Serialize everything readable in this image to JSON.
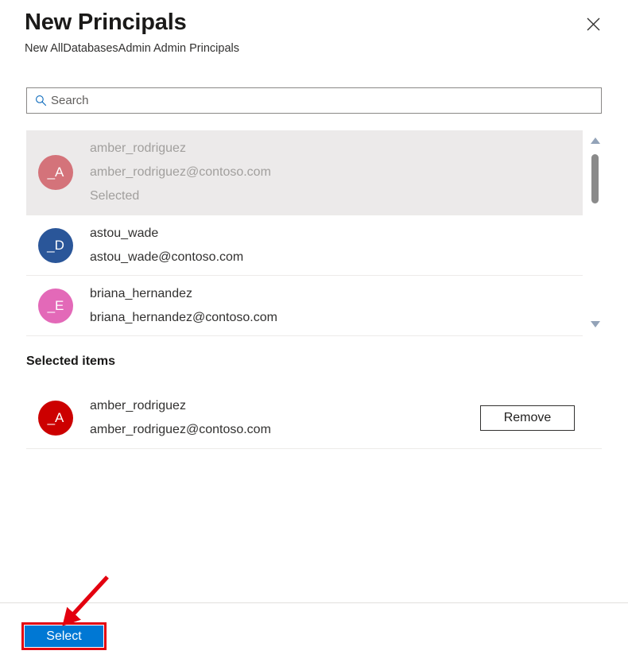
{
  "header": {
    "title": "New Principals",
    "subtitle": "New AllDatabasesAdmin Admin Principals",
    "close_icon": "close-icon"
  },
  "search": {
    "placeholder": "Search",
    "value": "",
    "icon": "search-icon"
  },
  "results": {
    "scrollbar": {
      "up_icon": "chevron-up-icon",
      "down_icon": "chevron-down-icon"
    },
    "items": [
      {
        "initials": "_A",
        "name": "amber_rodriguez",
        "email": "amber_rodriguez@contoso.com",
        "status": "Selected",
        "avatar_color": "#d4737a",
        "disabled": true
      },
      {
        "initials": "_D",
        "name": "astou_wade",
        "email": "astou_wade@contoso.com",
        "status": "",
        "avatar_color": "#2a5699",
        "disabled": false
      },
      {
        "initials": "_E",
        "name": "briana_hernandez",
        "email": "briana_hernandez@contoso.com",
        "status": "",
        "avatar_color": "#e369b8",
        "disabled": false
      }
    ]
  },
  "selected": {
    "heading": "Selected items",
    "items": [
      {
        "initials": "_A",
        "name": "amber_rodriguez",
        "email": "amber_rodriguez@contoso.com",
        "avatar_color": "#cc0000",
        "remove_label": "Remove"
      }
    ]
  },
  "footer": {
    "select_label": "Select",
    "accent_color": "#0078d4",
    "highlight_color": "#e3000f"
  }
}
